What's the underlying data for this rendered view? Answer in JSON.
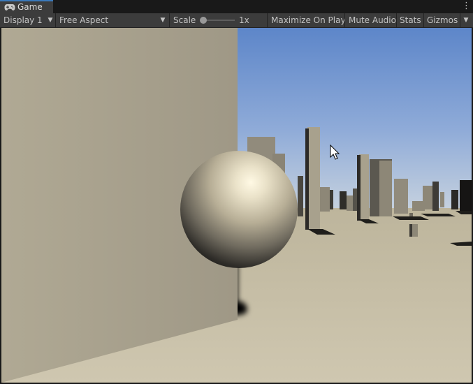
{
  "window": {
    "tab_label": "Game",
    "tab_icon": "gamepad-icon",
    "menu_icon": "kebab-menu-icon"
  },
  "toolbar": {
    "display": {
      "label": "Display 1"
    },
    "aspect": {
      "label": "Free Aspect"
    },
    "scale": {
      "label": "Scale",
      "value_label": "1x",
      "value": 1
    },
    "maximize_on_play": "Maximize On Play",
    "mute_audio": "Mute Audio",
    "stats": "Stats",
    "gizmos": "Gizmos"
  },
  "colors": {
    "toolbar_bg": "#3c3c3c",
    "tab_accent": "#3a79bb",
    "sky_top": "#5d86c9",
    "sky_horizon": "#c8d3df",
    "ground": "#c6bea6",
    "wall": "#a49d8b",
    "sphere_highlight": "#fff9e4"
  }
}
